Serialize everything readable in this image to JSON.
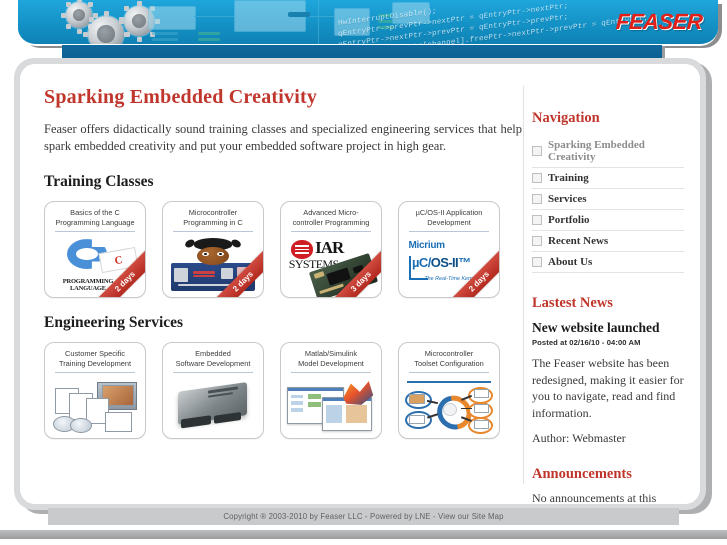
{
  "header": {
    "logo_text": "FEASER",
    "code_lines": [
      "HwInterruptDisable();",
      "qEntryPtr->prevPtr->nextPtr = qEntryPtr->nextPtr;",
      "qEntryPtr->nextPtr->prevPtr = qEntryPtr->prevPtr;",
      "qEntryPtr->nextPtr[channel].freePtr->nextPtr->prevPtr = qEntryPtr;",
      "qEntryPtr[channel].freePtr->nextPtr;"
    ]
  },
  "main": {
    "page_title": "Sparking Embedded Creativity",
    "intro": "Feaser offers didactically sound training classes and specialized engineering services that help spark embedded creativity and put your embedded software project in high gear.",
    "training_section_title": "Training Classes",
    "services_section_title": "Engineering Services",
    "training_cards": [
      {
        "title": "Basics of the C\nProgramming Language",
        "ribbon": "2 days",
        "art": "c-logo"
      },
      {
        "title": "Microcontroller\nProgramming in C",
        "ribbon": "2 days",
        "art": "gopher-board"
      },
      {
        "title": "Advanced Micro-\ncontroller Programming",
        "ribbon": "3 days",
        "art": "iar"
      },
      {
        "title": "µC/OS-II Application\nDevelopment",
        "ribbon": "2 days",
        "art": "micrium"
      }
    ],
    "service_cards": [
      {
        "title": "Customer Specific\nTraining Development",
        "art": "media"
      },
      {
        "title": "Embedded\nSoftware Development",
        "art": "ecu"
      },
      {
        "title": "Matlab/Simulink\nModel Development",
        "art": "matlab"
      },
      {
        "title": "Microcontroller\nToolset Configuration",
        "art": "toolchain"
      }
    ]
  },
  "sidebar": {
    "nav_title": "Navigation",
    "nav_items": [
      {
        "label": "Sparking Embedded Creativity",
        "current": true
      },
      {
        "label": "Training",
        "current": false
      },
      {
        "label": "Services",
        "current": false
      },
      {
        "label": "Portfolio",
        "current": false
      },
      {
        "label": "Recent News",
        "current": false
      },
      {
        "label": "About Us",
        "current": false
      }
    ],
    "news_title": "Lastest News",
    "news_headline": "New website launched",
    "news_date": "Posted at 02/16/10 - 04:00 AM",
    "news_body": "The Feaser website has been redesigned, making it easier for you to navigate, read and find information.",
    "news_author": "Author: Webmaster",
    "announcements_title": "Announcements",
    "announcements_body": "No announcements at this point."
  },
  "footer": {
    "text": "Copyright ® 2003-2010 by Feaser LLC - Powered by LNE - View our Site Map"
  },
  "colors": {
    "brand_red": "#c0362c",
    "logo_red": "#e02019",
    "header_blue": "#1c9dd2",
    "nav_strip_blue": "#0c5c8e",
    "panel_border": "#d9dadb",
    "ribbon_red": "#b32a1f"
  }
}
